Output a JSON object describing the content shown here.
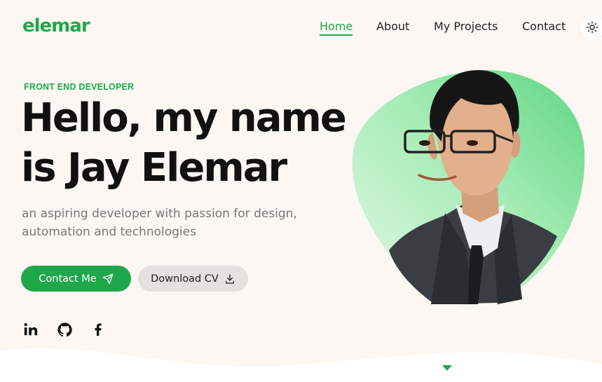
{
  "brand": {
    "logo": "elemar"
  },
  "nav": {
    "items": [
      {
        "label": "Home",
        "active": true
      },
      {
        "label": "About",
        "active": false
      },
      {
        "label": "My Projects",
        "active": false
      },
      {
        "label": "Contact",
        "active": false
      }
    ],
    "theme_toggle_icon": "sun-icon"
  },
  "hero": {
    "tagline": "FRONT END DEVELOPER",
    "headline_line1": "Hello, my name",
    "headline_line2": "is Jay Elemar",
    "subtitle_line1": "an aspiring developer with passion for design,",
    "subtitle_line2": "automation and technologies",
    "contact_button": "Contact Me",
    "contact_icon": "send-icon",
    "download_button": "Download CV",
    "download_icon": "download-icon"
  },
  "social": [
    {
      "icon": "linkedin-icon"
    },
    {
      "icon": "github-icon"
    },
    {
      "icon": "facebook-icon"
    }
  ],
  "colors": {
    "accent": "#1ea84b",
    "background": "#fcf7f3",
    "blob_light": "#c8f2d0",
    "blob_dark": "#66d98a"
  }
}
